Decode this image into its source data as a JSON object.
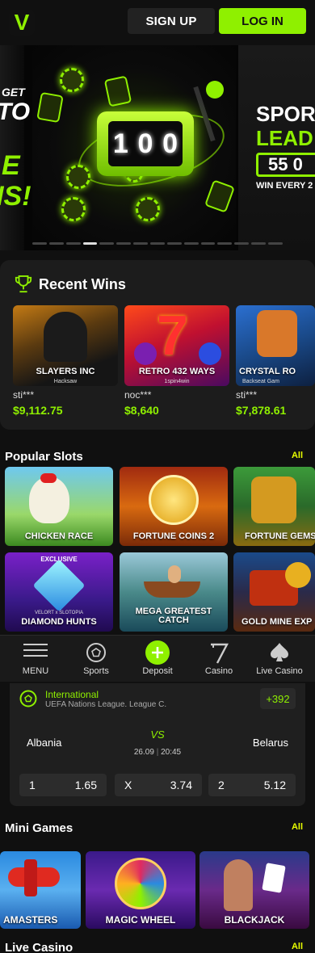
{
  "header": {
    "logo": "V",
    "signup_label": "SIGN UP",
    "login_label": "LOG IN"
  },
  "banner": {
    "left_lines": [
      "GET",
      "TO",
      "E",
      "NS!"
    ],
    "slot_digits": [
      "1",
      "0",
      "0"
    ],
    "right_line1": "SPOR",
    "right_line2": "LEAD",
    "right_amount": "55 0",
    "right_sub": "WIN EVERY 2",
    "dots_total": 15,
    "dots_active": 3
  },
  "recent_wins": {
    "title": "Recent Wins",
    "items": [
      {
        "game": "SLAYERS INC",
        "provider": "Hacksaw",
        "user": "sti***",
        "amount": "$9,112.75"
      },
      {
        "game": "RETRO 432 WAYS",
        "provider": "1spin4win",
        "user": "noc***",
        "amount": "$8,640"
      },
      {
        "game": "CRYSTAL RO",
        "provider": "Backseat Gam",
        "user": "sti***",
        "amount": "$7,878.61"
      }
    ]
  },
  "popular_slots": {
    "title": "Popular Slots",
    "all_label": "All",
    "games": [
      {
        "name": "CHICKEN RACE"
      },
      {
        "name": "FORTUNE COINS 2"
      },
      {
        "name": "FORTUNE GEMS"
      },
      {
        "name": "DIAMOND HUNTS",
        "badge": "EXCLUSIVE",
        "sub": "VELORT x SLOTOPIA"
      },
      {
        "name": "MEGA GREATEST CATCH"
      },
      {
        "name": "GOLD MINE EXP"
      }
    ]
  },
  "bottom_nav": {
    "items": [
      {
        "label": "MENU",
        "icon": "menu-icon"
      },
      {
        "label": "Sports",
        "icon": "soccer-ball-icon"
      },
      {
        "label": "Deposit",
        "icon": "plus-circle-icon"
      },
      {
        "label": "Casino",
        "icon": "seven-icon"
      },
      {
        "label": "Live Casino",
        "icon": "spade-icon"
      }
    ]
  },
  "match": {
    "league": "International",
    "competition": "UEFA Nations League. League C.",
    "more_markets": "+392",
    "home": "Albania",
    "away": "Belarus",
    "vs": "VS",
    "date": "26.09",
    "time": "20:45",
    "odds": [
      {
        "key": "1",
        "value": "1.65"
      },
      {
        "key": "X",
        "value": "3.74"
      },
      {
        "key": "2",
        "value": "5.12"
      }
    ]
  },
  "mini_games": {
    "title": "Mini Games",
    "all_label": "All",
    "games": [
      {
        "name": "AMASTERS"
      },
      {
        "name": "MAGIC WHEEL"
      },
      {
        "name": "BLACKJACK"
      }
    ]
  },
  "live_casino": {
    "title": "Live Casino",
    "all_label": "All"
  },
  "colors": {
    "accent": "#8ff000",
    "all_link": "#e8ff00",
    "background": "#101010"
  }
}
